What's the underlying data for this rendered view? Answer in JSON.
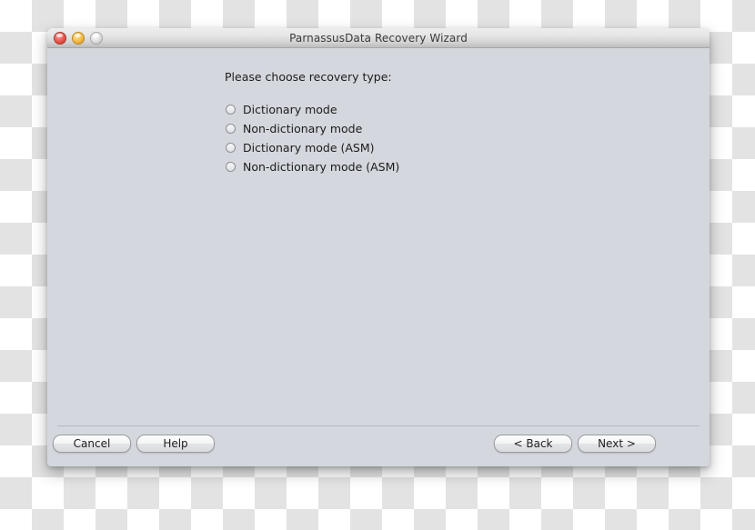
{
  "window": {
    "title": "ParnassusData Recovery Wizard",
    "traffic_lights": [
      {
        "name": "close",
        "color": "#e8554b"
      },
      {
        "name": "minimize",
        "color": "#f4bb3e"
      },
      {
        "name": "zoom",
        "color": "#dedede"
      }
    ]
  },
  "content": {
    "prompt": "Please choose recovery type:",
    "options": [
      {
        "label": "Dictionary mode",
        "selected": false
      },
      {
        "label": "Non-dictionary mode",
        "selected": false
      },
      {
        "label": "Dictionary mode (ASM)",
        "selected": false
      },
      {
        "label": "Non-dictionary mode (ASM)",
        "selected": false
      }
    ]
  },
  "footer": {
    "cancel_label": "Cancel",
    "help_label": "Help",
    "back_label": "<  Back",
    "next_label": "Next  >"
  },
  "theme": {
    "content_bg": "#d4d7dd",
    "titlebar_bottom": "#bdbdbd",
    "separator": "#b4b7bd",
    "text": "#1b1b1b"
  }
}
